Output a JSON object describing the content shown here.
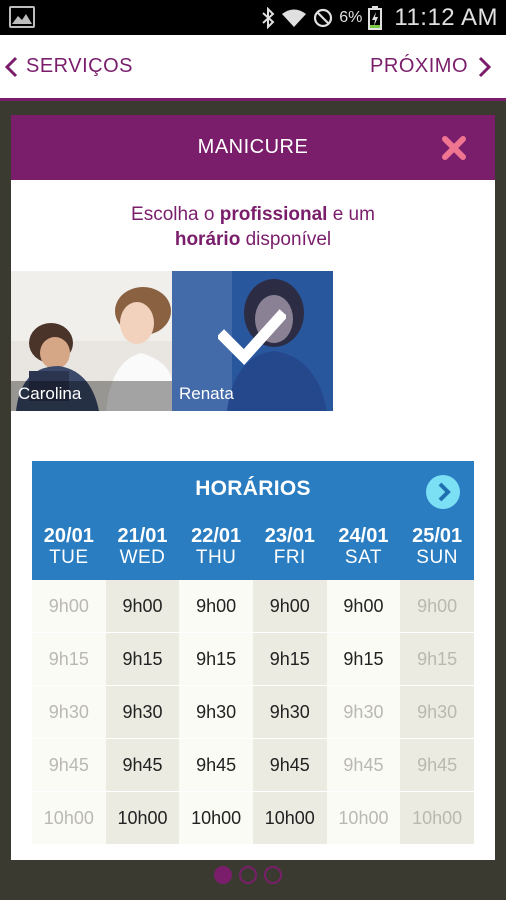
{
  "status_bar": {
    "battery_pct": "6%",
    "time": "11:12 AM",
    "icons": [
      "gallery-icon",
      "bluetooth-icon",
      "wifi-icon",
      "no-signal-icon",
      "battery-charging-icon"
    ]
  },
  "topnav": {
    "back_label": "SERVIÇOS",
    "next_label": "PRÓXIMO",
    "icons": [
      "chevron-left-icon",
      "chevron-right-icon"
    ]
  },
  "modal": {
    "title": "MANICURE",
    "instruction": {
      "line1_pre": "Escolha o ",
      "line1_bold": "profissional",
      "line1_post": " e um",
      "line2_bold": "horário",
      "line2_post": " disponível"
    },
    "professionals": [
      {
        "name": "Carolina",
        "selected": false
      },
      {
        "name": "Renata",
        "selected": true
      }
    ]
  },
  "schedule": {
    "title": "HORÁRIOS",
    "days": [
      {
        "date": "20/01",
        "dow": "TUE"
      },
      {
        "date": "21/01",
        "dow": "WED"
      },
      {
        "date": "22/01",
        "dow": "THU"
      },
      {
        "date": "23/01",
        "dow": "FRI"
      },
      {
        "date": "24/01",
        "dow": "SAT"
      },
      {
        "date": "25/01",
        "dow": "SUN"
      }
    ],
    "times": [
      "9h00",
      "9h15",
      "9h30",
      "9h45",
      "10h00"
    ],
    "availability": [
      [
        false,
        false,
        false,
        false,
        false
      ],
      [
        true,
        true,
        true,
        true,
        true
      ],
      [
        true,
        true,
        true,
        true,
        true
      ],
      [
        true,
        true,
        true,
        true,
        true
      ],
      [
        true,
        true,
        false,
        false,
        false
      ],
      [
        false,
        false,
        false,
        false,
        false
      ]
    ]
  },
  "colors": {
    "brand": "#7a1e6c",
    "schedule_blue": "#2a7dc0",
    "close": "#f07590",
    "next_circle": "#7ce0f5"
  },
  "pager": {
    "pages": 3,
    "active": 1
  }
}
